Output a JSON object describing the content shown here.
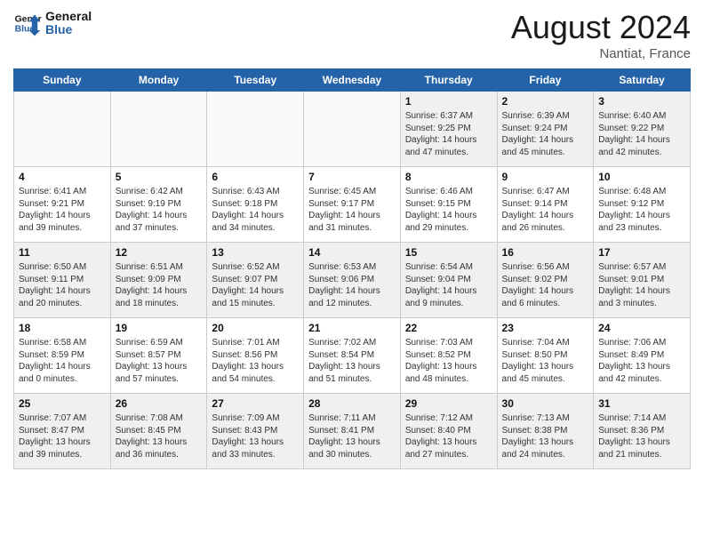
{
  "header": {
    "logo_line1": "General",
    "logo_line2": "Blue",
    "month_year": "August 2024",
    "location": "Nantiat, France"
  },
  "days_of_week": [
    "Sunday",
    "Monday",
    "Tuesday",
    "Wednesday",
    "Thursday",
    "Friday",
    "Saturday"
  ],
  "weeks": [
    [
      {
        "day": "",
        "content": "",
        "empty": true
      },
      {
        "day": "",
        "content": "",
        "empty": true
      },
      {
        "day": "",
        "content": "",
        "empty": true
      },
      {
        "day": "",
        "content": "",
        "empty": true
      },
      {
        "day": "1",
        "content": "Sunrise: 6:37 AM\nSunset: 9:25 PM\nDaylight: 14 hours and 47 minutes."
      },
      {
        "day": "2",
        "content": "Sunrise: 6:39 AM\nSunset: 9:24 PM\nDaylight: 14 hours and 45 minutes."
      },
      {
        "day": "3",
        "content": "Sunrise: 6:40 AM\nSunset: 9:22 PM\nDaylight: 14 hours and 42 minutes."
      }
    ],
    [
      {
        "day": "4",
        "content": "Sunrise: 6:41 AM\nSunset: 9:21 PM\nDaylight: 14 hours and 39 minutes."
      },
      {
        "day": "5",
        "content": "Sunrise: 6:42 AM\nSunset: 9:19 PM\nDaylight: 14 hours and 37 minutes."
      },
      {
        "day": "6",
        "content": "Sunrise: 6:43 AM\nSunset: 9:18 PM\nDaylight: 14 hours and 34 minutes."
      },
      {
        "day": "7",
        "content": "Sunrise: 6:45 AM\nSunset: 9:17 PM\nDaylight: 14 hours and 31 minutes."
      },
      {
        "day": "8",
        "content": "Sunrise: 6:46 AM\nSunset: 9:15 PM\nDaylight: 14 hours and 29 minutes."
      },
      {
        "day": "9",
        "content": "Sunrise: 6:47 AM\nSunset: 9:14 PM\nDaylight: 14 hours and 26 minutes."
      },
      {
        "day": "10",
        "content": "Sunrise: 6:48 AM\nSunset: 9:12 PM\nDaylight: 14 hours and 23 minutes."
      }
    ],
    [
      {
        "day": "11",
        "content": "Sunrise: 6:50 AM\nSunset: 9:11 PM\nDaylight: 14 hours and 20 minutes."
      },
      {
        "day": "12",
        "content": "Sunrise: 6:51 AM\nSunset: 9:09 PM\nDaylight: 14 hours and 18 minutes."
      },
      {
        "day": "13",
        "content": "Sunrise: 6:52 AM\nSunset: 9:07 PM\nDaylight: 14 hours and 15 minutes."
      },
      {
        "day": "14",
        "content": "Sunrise: 6:53 AM\nSunset: 9:06 PM\nDaylight: 14 hours and 12 minutes."
      },
      {
        "day": "15",
        "content": "Sunrise: 6:54 AM\nSunset: 9:04 PM\nDaylight: 14 hours and 9 minutes."
      },
      {
        "day": "16",
        "content": "Sunrise: 6:56 AM\nSunset: 9:02 PM\nDaylight: 14 hours and 6 minutes."
      },
      {
        "day": "17",
        "content": "Sunrise: 6:57 AM\nSunset: 9:01 PM\nDaylight: 14 hours and 3 minutes."
      }
    ],
    [
      {
        "day": "18",
        "content": "Sunrise: 6:58 AM\nSunset: 8:59 PM\nDaylight: 14 hours and 0 minutes."
      },
      {
        "day": "19",
        "content": "Sunrise: 6:59 AM\nSunset: 8:57 PM\nDaylight: 13 hours and 57 minutes."
      },
      {
        "day": "20",
        "content": "Sunrise: 7:01 AM\nSunset: 8:56 PM\nDaylight: 13 hours and 54 minutes."
      },
      {
        "day": "21",
        "content": "Sunrise: 7:02 AM\nSunset: 8:54 PM\nDaylight: 13 hours and 51 minutes."
      },
      {
        "day": "22",
        "content": "Sunrise: 7:03 AM\nSunset: 8:52 PM\nDaylight: 13 hours and 48 minutes."
      },
      {
        "day": "23",
        "content": "Sunrise: 7:04 AM\nSunset: 8:50 PM\nDaylight: 13 hours and 45 minutes."
      },
      {
        "day": "24",
        "content": "Sunrise: 7:06 AM\nSunset: 8:49 PM\nDaylight: 13 hours and 42 minutes."
      }
    ],
    [
      {
        "day": "25",
        "content": "Sunrise: 7:07 AM\nSunset: 8:47 PM\nDaylight: 13 hours and 39 minutes."
      },
      {
        "day": "26",
        "content": "Sunrise: 7:08 AM\nSunset: 8:45 PM\nDaylight: 13 hours and 36 minutes."
      },
      {
        "day": "27",
        "content": "Sunrise: 7:09 AM\nSunset: 8:43 PM\nDaylight: 13 hours and 33 minutes."
      },
      {
        "day": "28",
        "content": "Sunrise: 7:11 AM\nSunset: 8:41 PM\nDaylight: 13 hours and 30 minutes."
      },
      {
        "day": "29",
        "content": "Sunrise: 7:12 AM\nSunset: 8:40 PM\nDaylight: 13 hours and 27 minutes."
      },
      {
        "day": "30",
        "content": "Sunrise: 7:13 AM\nSunset: 8:38 PM\nDaylight: 13 hours and 24 minutes."
      },
      {
        "day": "31",
        "content": "Sunrise: 7:14 AM\nSunset: 8:36 PM\nDaylight: 13 hours and 21 minutes."
      }
    ]
  ]
}
